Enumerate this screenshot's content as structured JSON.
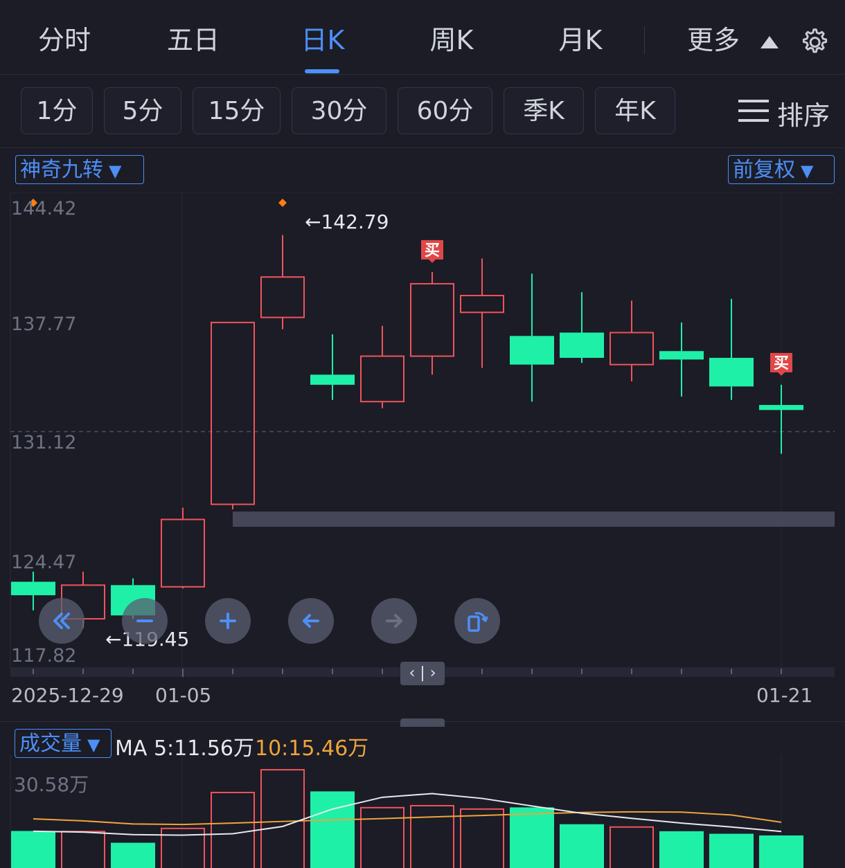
{
  "tabs": {
    "items": [
      {
        "label": "分时"
      },
      {
        "label": "五日"
      },
      {
        "label": "日K"
      },
      {
        "label": "周K"
      },
      {
        "label": "月K"
      },
      {
        "label": "更多"
      }
    ],
    "active": "日K"
  },
  "periods": {
    "items": [
      {
        "label": "1分"
      },
      {
        "label": "5分"
      },
      {
        "label": "15分"
      },
      {
        "label": "30分"
      },
      {
        "label": "60分"
      },
      {
        "label": "季K"
      },
      {
        "label": "年K"
      }
    ],
    "sort_label": "排序"
  },
  "indicator_dropdown": {
    "label": "神奇九转",
    "arrow": "▼"
  },
  "adjust_dropdown": {
    "label": "前复权",
    "arrow": "▼"
  },
  "volume_dropdown": {
    "label": "成交量",
    "arrow": "▼"
  },
  "volume_ma": {
    "ma5": "MA 5:11.56万",
    "ma10": "10:15.46万"
  },
  "colors": {
    "up": "#f0545a",
    "down": "#1ff0a8",
    "accent": "#4d8ff7",
    "ma10": "#f0a43a",
    "ma5": "#e8e9ee",
    "buy_marker": "#e04848",
    "top_marker": "#ff7f11"
  },
  "controls": [
    {
      "icon": "double-chevron-left-icon"
    },
    {
      "icon": "minus-icon"
    },
    {
      "icon": "plus-icon"
    },
    {
      "icon": "arrow-left-icon"
    },
    {
      "icon": "arrow-right-icon"
    },
    {
      "icon": "rotate-screen-icon"
    }
  ],
  "scroll_handle_label": "‹ | ›",
  "chart_data": {
    "type": "candlestick",
    "y_ticks": [
      "144.42",
      "137.77",
      "131.12",
      "124.47",
      "117.82"
    ],
    "ylim": [
      117.82,
      144.42
    ],
    "x_labels": [
      "2025-12-29",
      "01-05",
      "01-21"
    ],
    "high_label": "←142.79",
    "low_label": "←119.45",
    "reference_price": 131.12,
    "candles": [
      {
        "open": 122.2,
        "close": 121.4,
        "high": 122.8,
        "low": 120.5,
        "buy": false,
        "top_marker": true
      },
      {
        "open": 120.0,
        "close": 122.0,
        "high": 122.8,
        "low": 119.45,
        "buy": false,
        "top_marker": false
      },
      {
        "open": 122.0,
        "close": 120.2,
        "high": 122.4,
        "low": 120.0,
        "buy": false,
        "top_marker": false
      },
      {
        "open": 121.9,
        "close": 125.9,
        "high": 126.6,
        "low": 121.8,
        "buy": false,
        "top_marker": false
      },
      {
        "open": 126.8,
        "close": 137.6,
        "high": 137.6,
        "low": 126.5,
        "buy": false,
        "top_marker": false
      },
      {
        "open": 137.9,
        "close": 140.3,
        "high": 142.79,
        "low": 137.2,
        "buy": false,
        "top_marker": true
      },
      {
        "open": 134.5,
        "close": 133.9,
        "high": 136.9,
        "low": 133.0,
        "buy": false,
        "top_marker": false
      },
      {
        "open": 132.9,
        "close": 135.6,
        "high": 137.4,
        "low": 132.5,
        "buy": false,
        "top_marker": false
      },
      {
        "open": 135.6,
        "close": 139.9,
        "high": 140.6,
        "low": 134.5,
        "buy": true,
        "top_marker": false
      },
      {
        "open": 138.2,
        "close": 139.2,
        "high": 141.4,
        "low": 134.9,
        "buy": false,
        "top_marker": false
      },
      {
        "open": 136.8,
        "close": 135.1,
        "high": 140.5,
        "low": 132.9,
        "buy": false,
        "top_marker": false
      },
      {
        "open": 137.0,
        "close": 135.5,
        "high": 139.4,
        "low": 135.2,
        "buy": false,
        "top_marker": false
      },
      {
        "open": 135.1,
        "close": 137.0,
        "high": 138.9,
        "low": 134.1,
        "buy": false,
        "top_marker": false
      },
      {
        "open": 135.9,
        "close": 135.4,
        "high": 137.6,
        "low": 133.2,
        "buy": false,
        "top_marker": false
      },
      {
        "open": 135.5,
        "close": 133.8,
        "high": 139.0,
        "low": 133.0,
        "buy": false,
        "top_marker": false
      },
      {
        "open": 132.7,
        "close": 132.4,
        "high": 133.9,
        "low": 129.8,
        "buy": true,
        "top_marker": false
      }
    ],
    "volume": {
      "unit": "万",
      "max_label": "30.58万",
      "ymax": 30.58,
      "bars": [
        13.2,
        13.0,
        9.0,
        14.1,
        26.9,
        35.0,
        27.3,
        21.5,
        22.2,
        21.0,
        21.6,
        15.6,
        14.6,
        13.1,
        12.2,
        11.6
      ],
      "ma5": [
        13.1,
        12.8,
        11.9,
        11.7,
        12.2,
        14.8,
        21.0,
        25.2,
        26.5,
        24.8,
        22.1,
        19.5,
        17.7,
        16.0,
        14.6,
        13.0
      ],
      "ma10": [
        17.5,
        16.8,
        15.7,
        15.5,
        16.0,
        16.6,
        17.1,
        17.6,
        18.2,
        18.7,
        19.3,
        19.8,
        20.0,
        19.9,
        18.9,
        16.3
      ]
    }
  }
}
